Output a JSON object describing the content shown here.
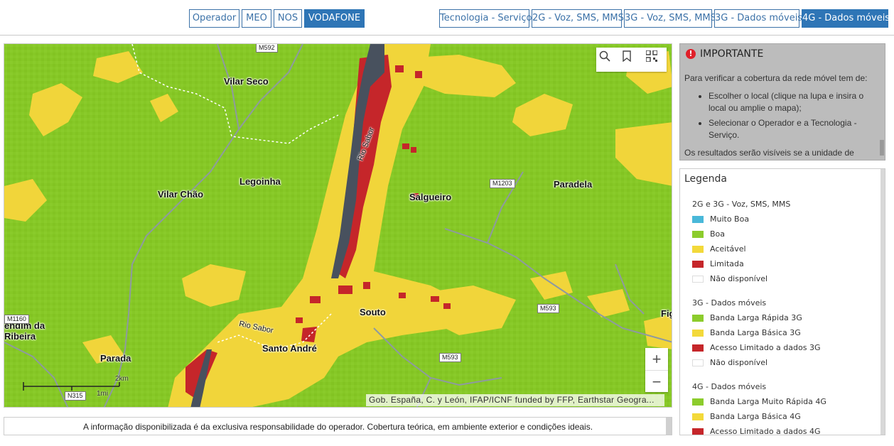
{
  "operators": [
    {
      "label": "Operador",
      "active": false
    },
    {
      "label": "MEO",
      "active": false
    },
    {
      "label": "NOS",
      "active": false
    },
    {
      "label": "VODAFONE",
      "active": true
    }
  ],
  "technologies": [
    {
      "label": "Tecnologia - Serviço",
      "active": false
    },
    {
      "label": "2G - Voz, SMS, MMS",
      "active": false
    },
    {
      "label": "3G - Voz, SMS, MMS",
      "active": false
    },
    {
      "label": "3G - Dados móveis",
      "active": false
    },
    {
      "label": "4G - Dados móveis",
      "active": true
    }
  ],
  "map": {
    "places": [
      "Vilar Seco",
      "Legoinha",
      "Vilar Chão",
      "Salgueiro",
      "Paradela",
      "Souto",
      "Santo André",
      "Parada",
      "endim da",
      "Ribeira",
      "Fig"
    ],
    "rivers": [
      "Rio Sabor",
      "Rio Sabor"
    ],
    "roads": [
      "M592",
      "M1203",
      "M593",
      "M593",
      "N315",
      "M1160"
    ],
    "attribution": "Gob. España, C. y León, IFAP/ICNF funded by FFP, Earthstar Geogra...",
    "scale": {
      "km_label": "2km",
      "mi_label": "1mi"
    },
    "tools": {
      "search": "search-icon",
      "bookmark": "bookmark-icon",
      "qr": "qr-code-icon"
    },
    "zoom": {
      "in": "+",
      "out": "−"
    }
  },
  "disclaimer": "A informação disponibilizada é da exclusiva responsabilidade do operador. Cobertura teórica, em ambiente exterior e condições ideais.",
  "important": {
    "title": "IMPORTANTE",
    "intro": "Para verificar a cobertura da rede móvel tem de:",
    "steps": [
      "Escolher o local (clique na lupa e insira o local ou amplie o mapa);",
      "Selecionar o Operador e a Tecnologia - Serviço."
    ],
    "footer": "Os resultados serão visíveis se a unidade de"
  },
  "legend": {
    "title": "Legenda",
    "sections": [
      {
        "title": "2G e 3G - Voz, SMS, MMS",
        "items": [
          {
            "label": "Muito Boa",
            "color": "#49b8d9"
          },
          {
            "label": "Boa",
            "color": "#8ccc2c"
          },
          {
            "label": "Aceitável",
            "color": "#f3d93a"
          },
          {
            "label": "Limitada",
            "color": "#c5262a"
          },
          {
            "label": "Não disponível",
            "color": "#ffffff"
          }
        ]
      },
      {
        "title": "3G - Dados móveis",
        "items": [
          {
            "label": "Banda Larga Rápida 3G",
            "color": "#8ccc2c"
          },
          {
            "label": "Banda Larga Básica 3G",
            "color": "#f3d93a"
          },
          {
            "label": "Acesso Limitado a dados 3G",
            "color": "#c5262a"
          },
          {
            "label": "Não disponível",
            "color": "#ffffff"
          }
        ]
      },
      {
        "title": "4G - Dados móveis",
        "items": [
          {
            "label": "Banda Larga Muito Rápida 4G",
            "color": "#8ccc2c"
          },
          {
            "label": "Banda Larga Básica 4G",
            "color": "#f3d93a"
          },
          {
            "label": "Acesso Limitado a dados 4G",
            "color": "#c5262a"
          }
        ]
      }
    ]
  }
}
